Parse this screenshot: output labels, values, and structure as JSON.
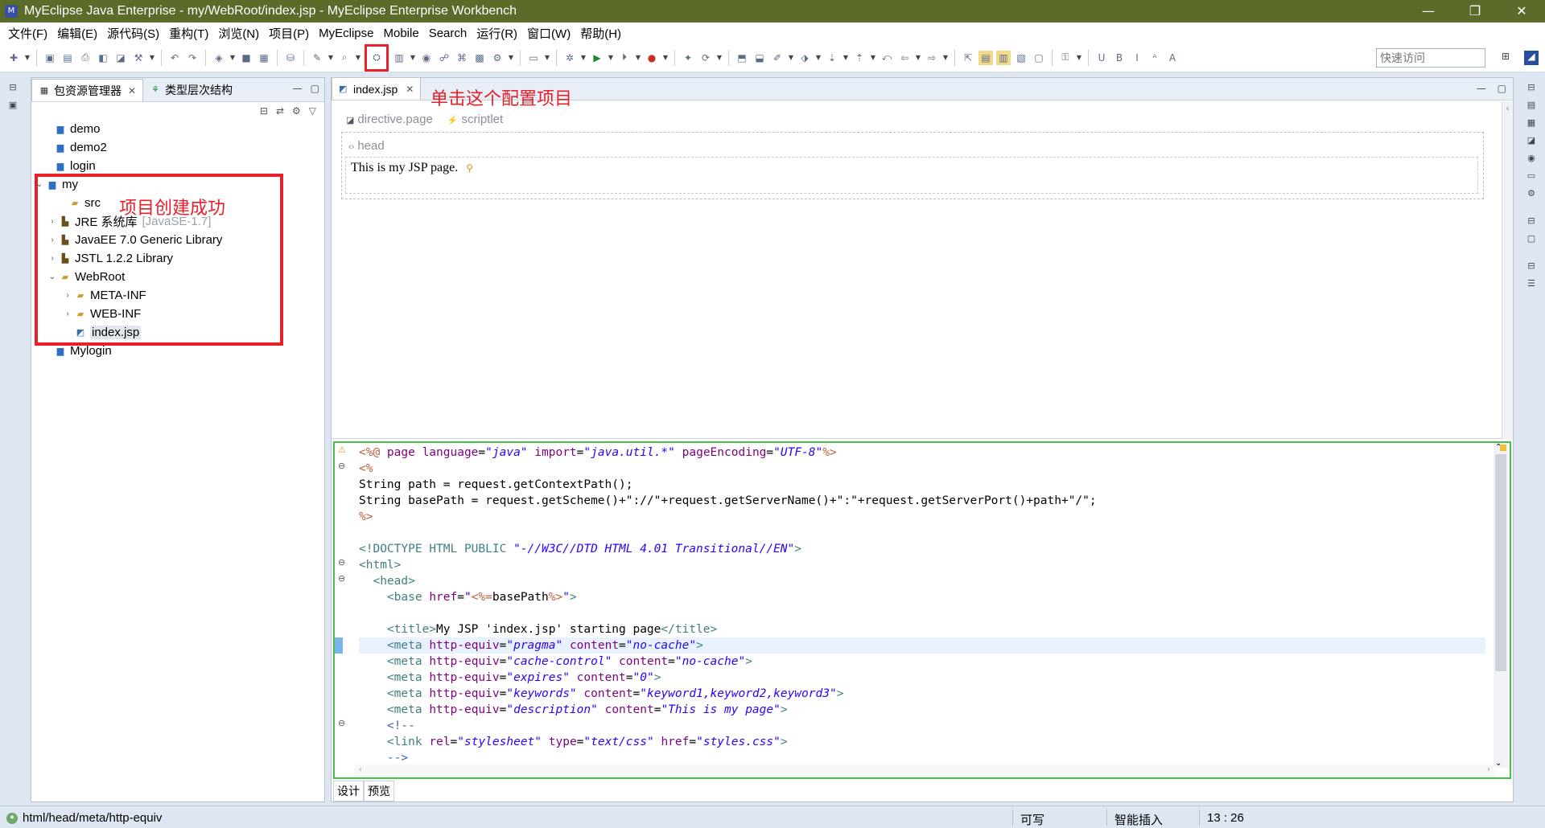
{
  "window": {
    "title": "MyEclipse Java Enterprise  -  my/WebRoot/index.jsp  -  MyEclipse Enterprise Workbench",
    "minimize": "—",
    "maximize": "❐",
    "close": "✕"
  },
  "menu": [
    "文件(F)",
    "编辑(E)",
    "源代码(S)",
    "重构(T)",
    "浏览(N)",
    "项目(P)",
    "MyEclipse",
    "Mobile",
    "Search",
    "运行(R)",
    "窗口(W)",
    "帮助(H)"
  ],
  "toolbar": {
    "quick_access_placeholder": "快速访问",
    "highlight_color": "#e8202a"
  },
  "package_explorer": {
    "tabs": [
      {
        "label": "包资源管理器",
        "active": true
      },
      {
        "label": "类型层次结构",
        "active": false
      }
    ],
    "tree": [
      {
        "label": "demo",
        "icon": "project-icon",
        "depth": 0
      },
      {
        "label": "demo2",
        "icon": "project-icon",
        "depth": 0
      },
      {
        "label": "login",
        "icon": "project-icon",
        "depth": 0
      },
      {
        "label": "my",
        "icon": "web-project-icon",
        "depth": 0,
        "expanded": true
      },
      {
        "label": "src",
        "icon": "source-folder-icon",
        "depth": 1
      },
      {
        "label": "JRE 系统库",
        "decoration": "[JavaSE-1.7]",
        "icon": "library-icon",
        "depth": 1,
        "collapsed": true
      },
      {
        "label": "JavaEE 7.0 Generic Library",
        "icon": "library-icon",
        "depth": 1,
        "collapsed": true
      },
      {
        "label": "JSTL 1.2.2 Library",
        "icon": "library-icon",
        "depth": 1,
        "collapsed": true
      },
      {
        "label": "WebRoot",
        "icon": "folder-open-icon",
        "depth": 1,
        "expanded": true
      },
      {
        "label": "META-INF",
        "icon": "folder-icon",
        "depth": 2,
        "collapsed": true
      },
      {
        "label": "WEB-INF",
        "icon": "folder-icon",
        "depth": 2,
        "collapsed": true
      },
      {
        "label": "index.jsp",
        "icon": "jsp-file-icon",
        "depth": 2,
        "selected": true
      },
      {
        "label": "Mylogin",
        "icon": "project-icon",
        "depth": 0
      }
    ],
    "annotation": "项目创建成功"
  },
  "editor": {
    "tab_label": "index.jsp",
    "annotation": "单击这个配置项目",
    "design": {
      "tags": [
        "directive.page",
        "scriptlet"
      ],
      "head_label": "head",
      "body_text": "This is my JSP page."
    },
    "source_lines": [
      [
        [
          "jsp",
          "<%@ "
        ],
        [
          "attr",
          "page "
        ],
        [
          "attr",
          "language"
        ],
        [
          "text",
          "="
        ],
        [
          "str",
          "\"java\""
        ],
        [
          "text",
          " "
        ],
        [
          "attr",
          "import"
        ],
        [
          "text",
          "="
        ],
        [
          "str",
          "\"java.util.*\""
        ],
        [
          "text",
          " "
        ],
        [
          "attr",
          "pageEncoding"
        ],
        [
          "text",
          "="
        ],
        [
          "str",
          "\"UTF-8\""
        ],
        [
          "jsp",
          "%>"
        ]
      ],
      [
        [
          "jsp",
          "<%"
        ]
      ],
      [
        [
          "text",
          "String path = request.getContextPath();"
        ]
      ],
      [
        [
          "text",
          "String basePath = request.getScheme()+\"://\"+request.getServerName()+\":\"+request.getServerPort()+path+\"/\";"
        ]
      ],
      [
        [
          "jsp",
          "%>"
        ]
      ],
      [
        [
          "text",
          ""
        ]
      ],
      [
        [
          "tag",
          "<!DOCTYPE HTML PUBLIC "
        ],
        [
          "str",
          "\"-//W3C//DTD HTML 4.01 Transitional//EN\""
        ],
        [
          "tag",
          ">"
        ]
      ],
      [
        [
          "tag",
          "<html>"
        ]
      ],
      [
        [
          "text",
          "  "
        ],
        [
          "tag",
          "<head>"
        ]
      ],
      [
        [
          "text",
          "    "
        ],
        [
          "tag",
          "<base "
        ],
        [
          "attr",
          "href"
        ],
        [
          "text",
          "="
        ],
        [
          "str",
          "\""
        ],
        [
          "jsp",
          "<%="
        ],
        [
          "text",
          "basePath"
        ],
        [
          "jsp",
          "%>"
        ],
        [
          "str",
          "\""
        ],
        [
          "tag",
          ">"
        ]
      ],
      [
        [
          "text",
          ""
        ]
      ],
      [
        [
          "text",
          "    "
        ],
        [
          "tag",
          "<title>"
        ],
        [
          "text",
          "My JSP 'index.jsp' starting page"
        ],
        [
          "tag",
          "</title>"
        ]
      ],
      [
        [
          "text",
          "    "
        ],
        [
          "tag",
          "<meta "
        ],
        [
          "attr",
          "http-equiv"
        ],
        [
          "text",
          "="
        ],
        [
          "str",
          "\"pragma\""
        ],
        [
          "text",
          " "
        ],
        [
          "attr",
          "content"
        ],
        [
          "text",
          "="
        ],
        [
          "str",
          "\"no-cache\""
        ],
        [
          "tag",
          ">"
        ]
      ],
      [
        [
          "text",
          "    "
        ],
        [
          "tag",
          "<meta "
        ],
        [
          "attr",
          "http-equiv"
        ],
        [
          "text",
          "="
        ],
        [
          "str",
          "\"cache-control\""
        ],
        [
          "text",
          " "
        ],
        [
          "attr",
          "content"
        ],
        [
          "text",
          "="
        ],
        [
          "str",
          "\"no-cache\""
        ],
        [
          "tag",
          ">"
        ]
      ],
      [
        [
          "text",
          "    "
        ],
        [
          "tag",
          "<meta "
        ],
        [
          "attr",
          "http-equiv"
        ],
        [
          "text",
          "="
        ],
        [
          "str",
          "\"expires\""
        ],
        [
          "text",
          " "
        ],
        [
          "attr",
          "content"
        ],
        [
          "text",
          "="
        ],
        [
          "str",
          "\"0\""
        ],
        [
          "tag",
          ">"
        ]
      ],
      [
        [
          "text",
          "    "
        ],
        [
          "tag",
          "<meta "
        ],
        [
          "attr",
          "http-equiv"
        ],
        [
          "text",
          "="
        ],
        [
          "str",
          "\"keywords\""
        ],
        [
          "text",
          " "
        ],
        [
          "attr",
          "content"
        ],
        [
          "text",
          "="
        ],
        [
          "str",
          "\"keyword1,keyword2,keyword3\""
        ],
        [
          "tag",
          ">"
        ]
      ],
      [
        [
          "text",
          "    "
        ],
        [
          "tag",
          "<meta "
        ],
        [
          "attr",
          "http-equiv"
        ],
        [
          "text",
          "="
        ],
        [
          "str",
          "\"description\""
        ],
        [
          "text",
          " "
        ],
        [
          "attr",
          "content"
        ],
        [
          "text",
          "="
        ],
        [
          "str",
          "\"This is my page\""
        ],
        [
          "tag",
          ">"
        ]
      ],
      [
        [
          "text",
          "    "
        ],
        [
          "com",
          "<!--"
        ]
      ],
      [
        [
          "text",
          "    "
        ],
        [
          "tag",
          "<link "
        ],
        [
          "attr",
          "rel"
        ],
        [
          "text",
          "="
        ],
        [
          "str",
          "\"stylesheet\""
        ],
        [
          "text",
          " "
        ],
        [
          "attr",
          "type"
        ],
        [
          "text",
          "="
        ],
        [
          "str",
          "\"text/css\""
        ],
        [
          "text",
          " "
        ],
        [
          "attr",
          "href"
        ],
        [
          "text",
          "="
        ],
        [
          "str",
          "\"styles.css\""
        ],
        [
          "tag",
          ">"
        ]
      ],
      [
        [
          "text",
          "    "
        ],
        [
          "com",
          "-->"
        ]
      ]
    ],
    "current_line_index": 12,
    "mode_tabs": [
      "设计",
      "预览"
    ]
  },
  "statusbar": {
    "path": "html/head/meta/http-equiv",
    "writable": "可写",
    "insert_mode": "智能插入",
    "position": "13 :  26"
  }
}
